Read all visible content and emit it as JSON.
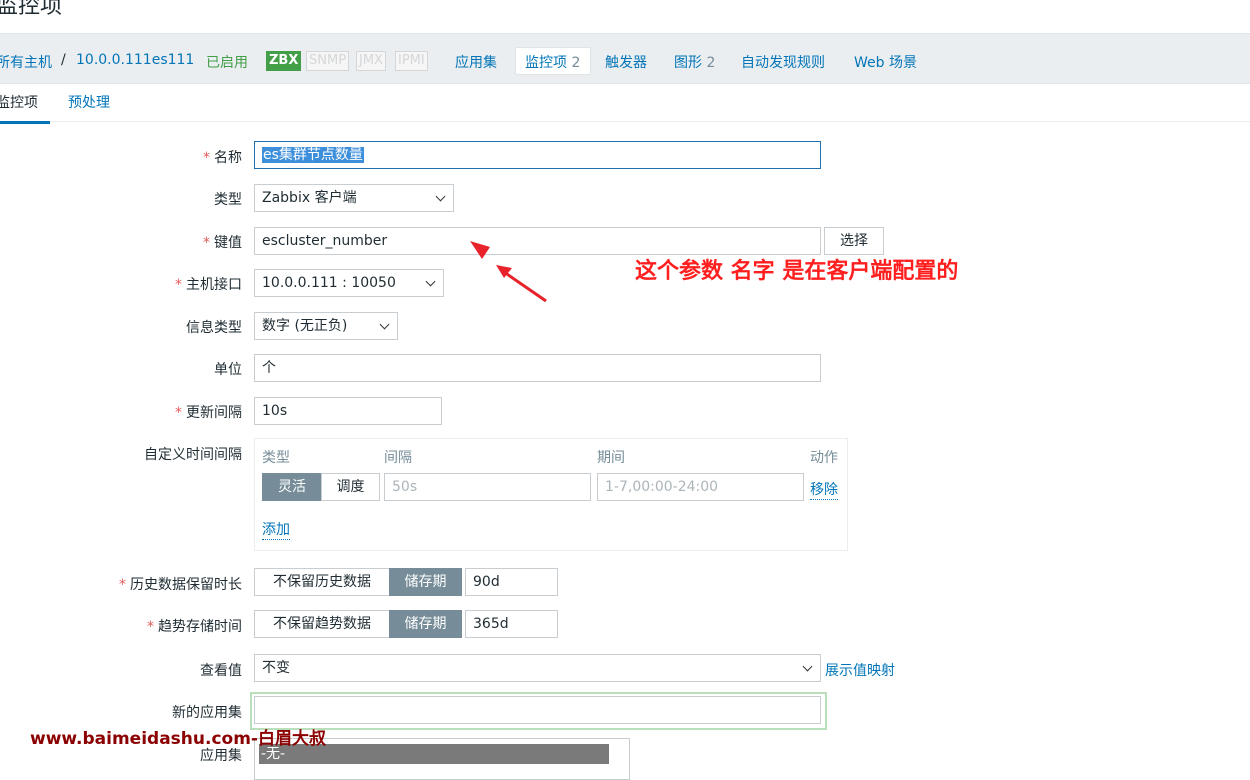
{
  "page": {
    "title": "监控项"
  },
  "breadcrumb": {
    "all_hosts": "所有主机",
    "separator": "/",
    "host": "10.0.0.111es111",
    "status": "已启用",
    "tags": [
      "ZBX",
      "SNMP",
      "JMX",
      "IPMI"
    ],
    "tabs": [
      {
        "label": "应用集",
        "count": ""
      },
      {
        "label": "监控项",
        "count": "2"
      },
      {
        "label": "触发器",
        "count": ""
      },
      {
        "label": "图形",
        "count": "2"
      },
      {
        "label": "自动发现规则",
        "count": ""
      },
      {
        "label": "Web 场景",
        "count": ""
      }
    ]
  },
  "subtabs": {
    "items": "监控项",
    "preprocess": "预处理"
  },
  "form": {
    "name_label": "名称",
    "name_value": "es集群节点数量",
    "type_label": "类型",
    "type_value": "Zabbix 客户端",
    "key_label": "键值",
    "key_value": "escluster_number",
    "key_select": "选择",
    "interface_label": "主机接口",
    "interface_value": "10.0.0.111 : 10050",
    "info_type_label": "信息类型",
    "info_type_value": "数字 (无正负)",
    "units_label": "单位",
    "units_value": "个",
    "interval_label": "更新间隔",
    "interval_value": "10s",
    "custom_label": "自定义时间间隔",
    "custom": {
      "col_type": "类型",
      "col_interval": "间隔",
      "col_period": "期间",
      "col_action": "动作",
      "btn_flexible": "灵活",
      "btn_scheduling": "调度",
      "interval_placeholder": "50s",
      "period_placeholder": "1-7,00:00-24:00",
      "remove": "移除",
      "add": "添加"
    },
    "history_label": "历史数据保留时长",
    "history_no_keep": "不保留历史数据",
    "history_storage": "储存期",
    "history_value": "90d",
    "trend_label": "趋势存储时间",
    "trend_no_keep": "不保留趋势数据",
    "trend_storage": "储存期",
    "trend_value": "365d",
    "showvalue_label": "查看值",
    "showvalue_value": "不变",
    "showvalue_link": "展示值映射",
    "new_app_label": "新的应用集",
    "app_label": "应用集",
    "app_selected": "-无-"
  },
  "annotation": {
    "text": "这个参数 名字 是在客户端配置的"
  },
  "watermark": {
    "text": "www.baimeidashu.com-白眉大叔"
  },
  "colors": {
    "link": "#0275b8",
    "green": "#429e47",
    "required": "#e45959",
    "annotation": "#ff1f1f"
  }
}
